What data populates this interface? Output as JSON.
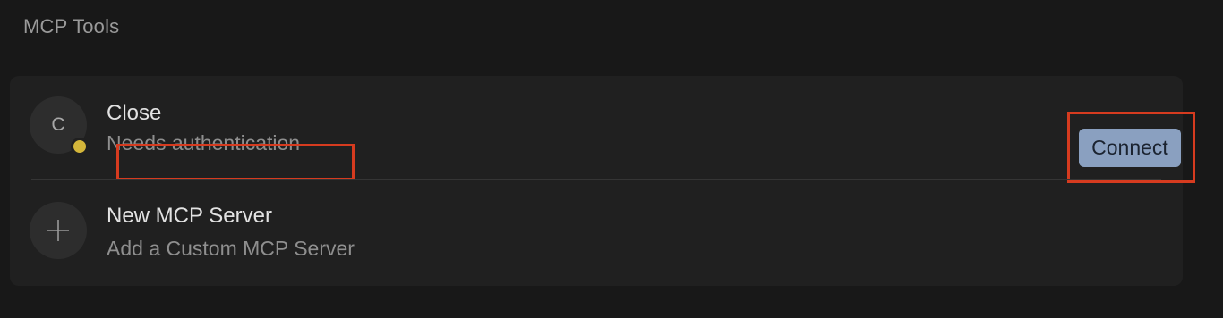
{
  "section": {
    "title": "MCP Tools"
  },
  "servers": [
    {
      "avatar_letter": "C",
      "name": "Close",
      "status_text": "Needs authentication",
      "status_color": "#d4b63a",
      "action_label": "Connect",
      "action_color": "#8aa0c0"
    }
  ],
  "new_server": {
    "icon": "plus-icon",
    "title": "New MCP Server",
    "subtitle": "Add a Custom MCP Server"
  },
  "highlights": {
    "color": "#d63b1f"
  }
}
